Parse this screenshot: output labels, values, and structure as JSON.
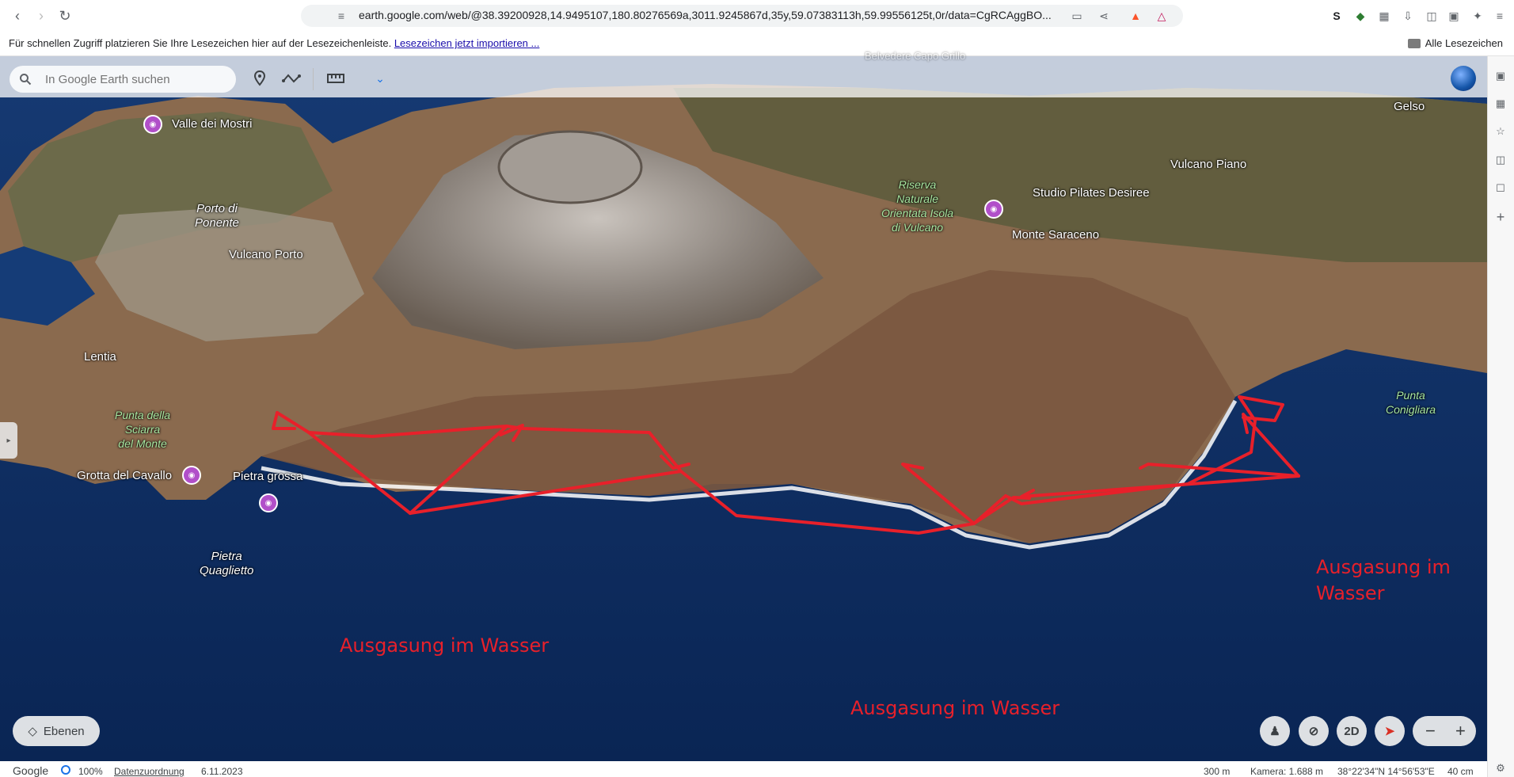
{
  "browser": {
    "url": "earth.google.com/web/@38.39200928,14.9495107,180.80276569a,3011.9245867d,35y,59.07383113h,59.99556125t,0r/data=CgRCAggBO...",
    "bookmark_hint": "Für schnellen Zugriff platzieren Sie Ihre Lesezeichen hier auf der Lesezeichenleiste.",
    "bookmark_import_link": "Lesezeichen jetzt importieren ...",
    "all_bookmarks": "Alle Lesezeichen"
  },
  "earth": {
    "search_placeholder": "In Google Earth suchen",
    "top_faded_label": "Belvedere Capo Grillo",
    "layers_button": "Ebenen",
    "view_2d": "2D"
  },
  "places": {
    "valle_dei_mostri": "Valle dei Mostri",
    "porto_di_ponente_1": "Porto di",
    "porto_di_ponente_2": "Ponente",
    "vulcano_porto": "Vulcano Porto",
    "lentia": "Lentia",
    "punta_sciarra_1": "Punta della",
    "punta_sciarra_2": "Sciarra",
    "punta_sciarra_3": "del Monte",
    "grotta_del_cavallo": "Grotta del Cavallo",
    "pietra_grossa": "Pietra grossa",
    "pietra_quaglietto_1": "Pietra",
    "pietra_quaglietto_2": "Quaglietto",
    "riserva_1": "Riserva",
    "riserva_2": "Naturale",
    "riserva_3": "Orientata Isola",
    "riserva_4": "di Vulcano",
    "studio_pilates": "Studio Pilates Desiree",
    "monte_saraceno": "Monte Saraceno",
    "vulcano_piano": "Vulcano Piano",
    "gelso": "Gelso",
    "punta_conigliara_1": "Punta",
    "punta_conigliara_2": "Conigliara"
  },
  "annotations": {
    "left": "Ausgasung im Wasser",
    "middle": "Ausgasung im Wasser",
    "right_1": "Ausgasung im",
    "right_2": "Wasser"
  },
  "status": {
    "brand": "Google",
    "loading": "100%",
    "attribution": "Datenzuordnung",
    "date": "6.11.2023",
    "scale": "300 m",
    "camera": "Kamera: 1.688 m",
    "coords": "38°22'34\"N 14°56'53\"E",
    "altitude": "40 cm"
  },
  "colors": {
    "annotation_red": "#e8202a",
    "sea": "#0b2a57",
    "pin_purple": "#b14fc9"
  }
}
